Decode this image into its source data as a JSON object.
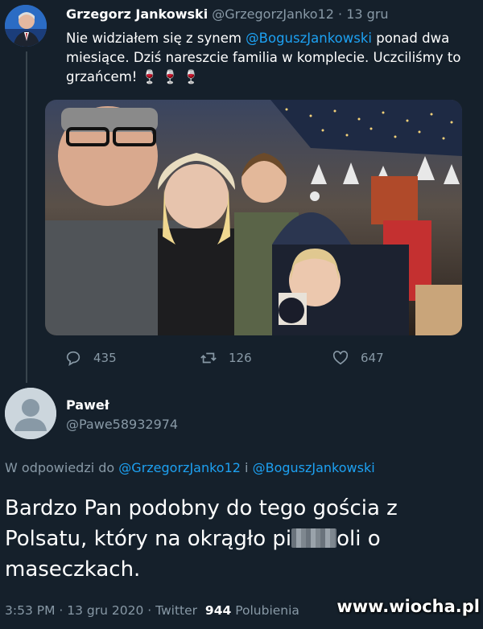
{
  "tweet": {
    "author_name": "Grzegorz Jankowski",
    "author_handle": "@GrzegorzJanko12",
    "separator": "·",
    "date": "13 gru",
    "text_part1": "Nie widziałem się z synem ",
    "text_mention": "@BoguszJankowski",
    "text_part2": " ponad dwa miesiące. Dziś nareszcie familia w komplecie. Uczciliśmy to grzańcem! 🍷 🍷 🍷",
    "actions": {
      "replies": "435",
      "retweets": "126",
      "likes": "647"
    }
  },
  "reply": {
    "author_name": "Paweł",
    "author_handle": "@Pawe58932974",
    "replying_prefix": "W odpowiedzi do",
    "replying_user1": "@GrzegorzJanko12",
    "replying_and": "i",
    "replying_user2": "@BoguszJankowski",
    "text_part1": "Bardzo Pan podobny do tego gościa z Polsatu, który na okrągło pi",
    "text_part2": "oli o maseczkach.",
    "time": "3:53 PM",
    "date": "13 gru 2020",
    "source": "Twitter",
    "likes_count": "944",
    "likes_label": "Polubienia"
  },
  "watermark": "www.wiocha.pl",
  "colors": {
    "background": "#15202b",
    "link": "#1da1f2",
    "muted": "#8899a6"
  },
  "icons": [
    "reply-icon",
    "retweet-icon",
    "like-icon",
    "default-avatar-icon"
  ]
}
